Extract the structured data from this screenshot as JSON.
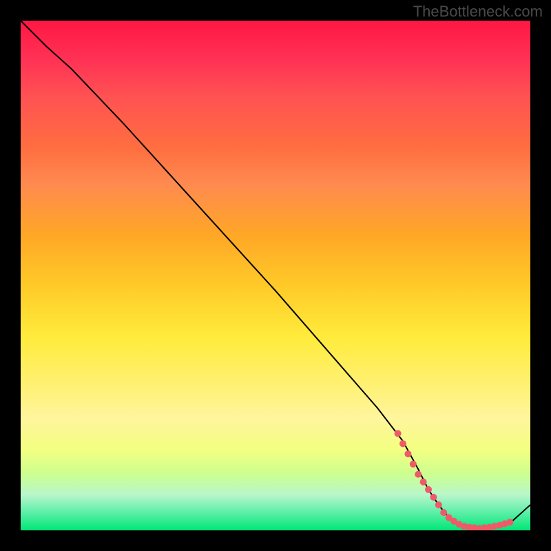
{
  "watermark": "TheBottleneck.com",
  "chart_data": {
    "type": "line",
    "title": "",
    "xlabel": "",
    "ylabel": "",
    "xlim": [
      0,
      100
    ],
    "ylim": [
      0,
      100
    ],
    "series": [
      {
        "name": "curve",
        "x": [
          0,
          5,
          10,
          20,
          30,
          40,
          50,
          60,
          70,
          75,
          78,
          80,
          82,
          84,
          86,
          88,
          90,
          93,
          96,
          100
        ],
        "y": [
          100,
          95,
          90.5,
          80,
          69,
          58,
          47,
          35.5,
          24,
          17.5,
          12,
          8,
          5,
          2.5,
          1.2,
          0.6,
          0.4,
          0.6,
          1.4,
          5
        ]
      }
    ],
    "markers": {
      "name": "red-dots",
      "x": [
        74,
        75,
        76,
        77,
        78,
        79,
        80,
        81,
        82,
        83,
        84,
        85,
        86,
        87,
        88,
        89,
        90,
        91,
        92,
        93,
        94,
        95,
        96
      ],
      "y": [
        19,
        17,
        15,
        13,
        11,
        9.5,
        8,
        6.5,
        5,
        3.5,
        2.5,
        1.8,
        1.2,
        0.8,
        0.6,
        0.5,
        0.4,
        0.5,
        0.6,
        0.8,
        1.0,
        1.3,
        1.6
      ]
    },
    "gradient_stops": [
      {
        "pos": 0,
        "color": "#ff1744"
      },
      {
        "pos": 50,
        "color": "#ffeb3b"
      },
      {
        "pos": 100,
        "color": "#00e676"
      }
    ]
  }
}
